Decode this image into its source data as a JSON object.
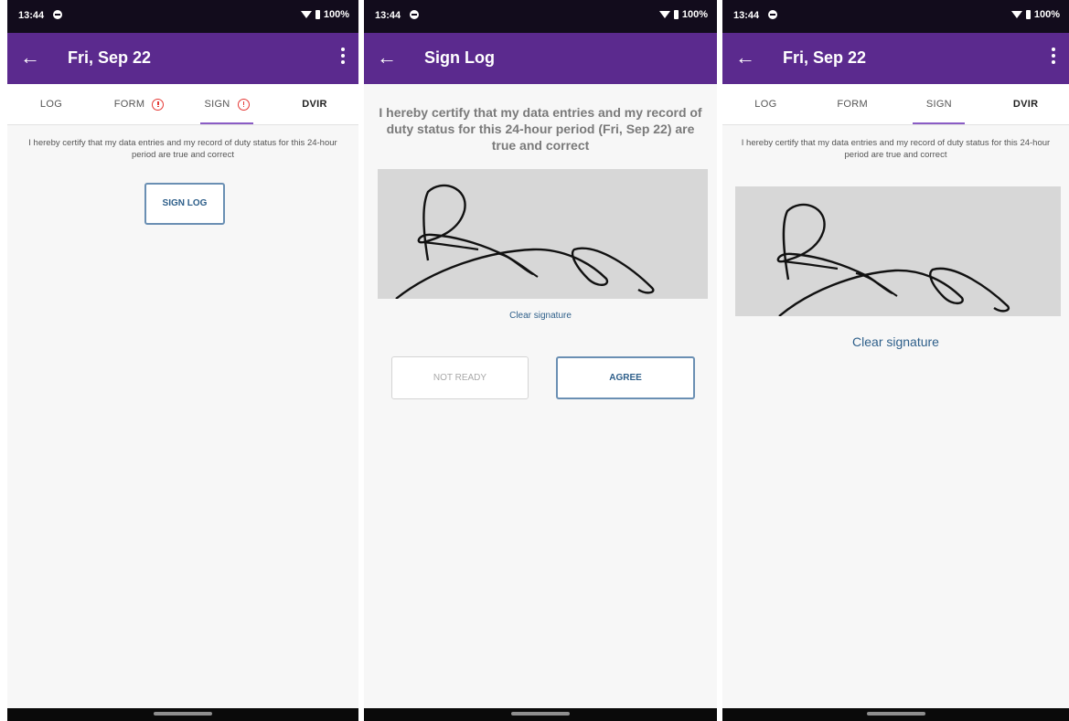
{
  "screens": [
    {
      "status": {
        "time": "13:44",
        "battery": "100%"
      },
      "title": "Fri, Sep 22",
      "tabs": [
        {
          "label": "LOG"
        },
        {
          "label": "FORM"
        },
        {
          "label": "SIGN"
        },
        {
          "label": "DVIR"
        }
      ],
      "certify_text": "I hereby certify that my data entries and my record of duty status for this 24-hour period are true and correct",
      "sign_log_label": "SIGN LOG"
    },
    {
      "status": {
        "time": "13:44",
        "battery": "100%"
      },
      "title": "Sign Log",
      "certify_text": "I hereby certify that my data entries and my record of duty status for this 24-hour period (Fri, Sep 22) are true and correct",
      "clear_label": "Clear signature",
      "not_ready_label": "NOT READY",
      "agree_label": "AGREE"
    },
    {
      "status": {
        "time": "13:44",
        "battery": "100%"
      },
      "title": "Fri, Sep 22",
      "tabs": [
        {
          "label": "LOG"
        },
        {
          "label": "FORM"
        },
        {
          "label": "SIGN"
        },
        {
          "label": "DVIR"
        }
      ],
      "certify_text": "I hereby certify that my data entries and my record of duty status for this 24-hour period are true and correct",
      "clear_label": "Clear signature"
    }
  ],
  "colors": {
    "app_bar": "#5b2a8e",
    "status_bar": "#120c1c",
    "tab_indicator": "#8a5cc5",
    "alert": "#e53935",
    "link": "#2e5f8a",
    "signature_pad": "#d7d7d7"
  },
  "icons": {
    "back": "arrow-left-icon",
    "more": "more-vert-icon",
    "alert": "alert-circle-icon",
    "wifi": "wifi-icon",
    "battery": "battery-icon",
    "dnd": "do-not-disturb-icon"
  }
}
